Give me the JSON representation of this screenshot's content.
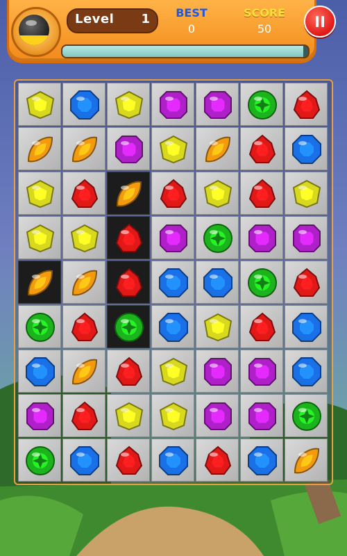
{
  "hud": {
    "level_label": "Level",
    "level_value": "1",
    "best_label": "BEST",
    "best_value": "0",
    "score_label": "SCORE",
    "score_value": "50",
    "progress_fraction": 0.98
  },
  "gem_colors": {
    "yellow": "#d8d81e",
    "blue": "#1a70e6",
    "purple": "#b020c8",
    "green": "#1cb41c",
    "red": "#e01818",
    "orange": "#f29a10"
  },
  "board": {
    "rows": 9,
    "cols": 7,
    "grid": [
      [
        "yellow",
        "blue",
        "yellow",
        "purple",
        "purple",
        "green",
        "red"
      ],
      [
        "orange",
        "orange",
        "purple",
        "yellow",
        "orange",
        "red",
        "blue"
      ],
      [
        "yellow",
        "red",
        "orange",
        "red",
        "yellow",
        "red",
        "yellow"
      ],
      [
        "yellow",
        "yellow",
        "red",
        "purple",
        "green",
        "purple",
        "purple"
      ],
      [
        "orange",
        "orange",
        "red",
        "blue",
        "blue",
        "green",
        "red"
      ],
      [
        "green",
        "red",
        "green",
        "blue",
        "yellow",
        "red",
        "blue"
      ],
      [
        "blue",
        "orange",
        "red",
        "yellow",
        "purple",
        "purple",
        "blue"
      ],
      [
        "purple",
        "red",
        "yellow",
        "yellow",
        "purple",
        "purple",
        "green"
      ],
      [
        "green",
        "blue",
        "red",
        "blue",
        "red",
        "blue",
        "orange"
      ]
    ],
    "highlighted_cells": [
      [
        2,
        2
      ],
      [
        3,
        2
      ],
      [
        4,
        0
      ],
      [
        4,
        2
      ],
      [
        5,
        2
      ]
    ]
  }
}
